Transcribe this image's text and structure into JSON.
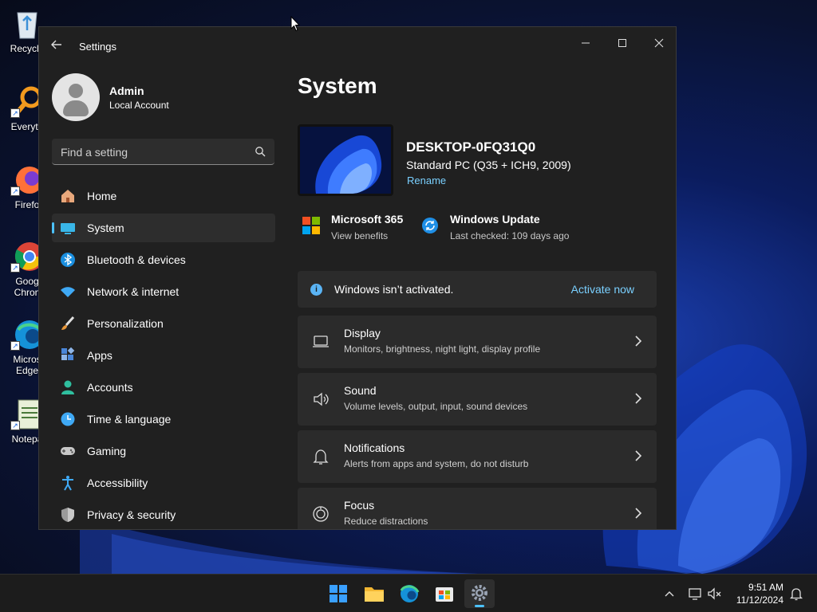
{
  "desktop": {
    "icons": [
      {
        "label": "Recycle",
        "icon": "recycle-bin-icon"
      },
      {
        "label": "Everyth",
        "icon": "everything-search-icon"
      },
      {
        "label": "Firefo",
        "icon": "firefox-icon"
      },
      {
        "label": "Goog",
        "label2": "Chron",
        "icon": "chrome-icon"
      },
      {
        "label": "Micros",
        "label2": "Edge",
        "icon": "edge-icon"
      },
      {
        "label": "Notepa",
        "icon": "notepad-icon"
      }
    ]
  },
  "window": {
    "title": "Settings",
    "controls": {
      "minimize": "─",
      "maximize": "☐",
      "close": "✕"
    }
  },
  "profile": {
    "name": "Admin",
    "account_type": "Local Account"
  },
  "search": {
    "placeholder": "Find a setting"
  },
  "nav": {
    "items": [
      {
        "label": "Home",
        "icon": "home-icon"
      },
      {
        "label": "System",
        "icon": "system-icon",
        "active": true
      },
      {
        "label": "Bluetooth & devices",
        "icon": "bluetooth-icon"
      },
      {
        "label": "Network & internet",
        "icon": "wifi-icon"
      },
      {
        "label": "Personalization",
        "icon": "brush-icon"
      },
      {
        "label": "Apps",
        "icon": "apps-icon"
      },
      {
        "label": "Accounts",
        "icon": "accounts-icon"
      },
      {
        "label": "Time & language",
        "icon": "time-language-icon"
      },
      {
        "label": "Gaming",
        "icon": "gaming-icon"
      },
      {
        "label": "Accessibility",
        "icon": "accessibility-icon"
      },
      {
        "label": "Privacy & security",
        "icon": "shield-icon"
      }
    ]
  },
  "main": {
    "title": "System",
    "device": {
      "name": "DESKTOP-0FQ31Q0",
      "model": "Standard PC (Q35 + ICH9, 2009)",
      "rename": "Rename"
    },
    "quick_links": [
      {
        "title": "Microsoft 365",
        "subtitle": "View benefits",
        "icon": "microsoft-365-icon"
      },
      {
        "title": "Windows Update",
        "subtitle": "Last checked: 109 days ago",
        "icon": "windows-update-icon"
      }
    ],
    "activation": {
      "text": "Windows isn’t activated.",
      "action": "Activate now"
    },
    "cards": [
      {
        "title": "Display",
        "subtitle": "Monitors, brightness, night light, display profile",
        "icon": "display-icon"
      },
      {
        "title": "Sound",
        "subtitle": "Volume levels, output, input, sound devices",
        "icon": "speaker-icon"
      },
      {
        "title": "Notifications",
        "subtitle": "Alerts from apps and system, do not disturb",
        "icon": "bell-icon"
      },
      {
        "title": "Focus",
        "subtitle": "Reduce distractions",
        "icon": "focus-icon"
      }
    ]
  },
  "taskbar": {
    "apps": [
      {
        "icon": "start-icon"
      },
      {
        "icon": "file-explorer-icon"
      },
      {
        "icon": "edge-icon"
      },
      {
        "icon": "store-icon"
      },
      {
        "icon": "settings-icon",
        "active": true
      }
    ],
    "clock": {
      "time": "9:51 AM",
      "date": "11/12/2024"
    }
  },
  "colors": {
    "accent": "#4cc2ff",
    "link": "#7ad0ff",
    "window_bg": "#202020",
    "card_bg": "#2b2b2b"
  }
}
